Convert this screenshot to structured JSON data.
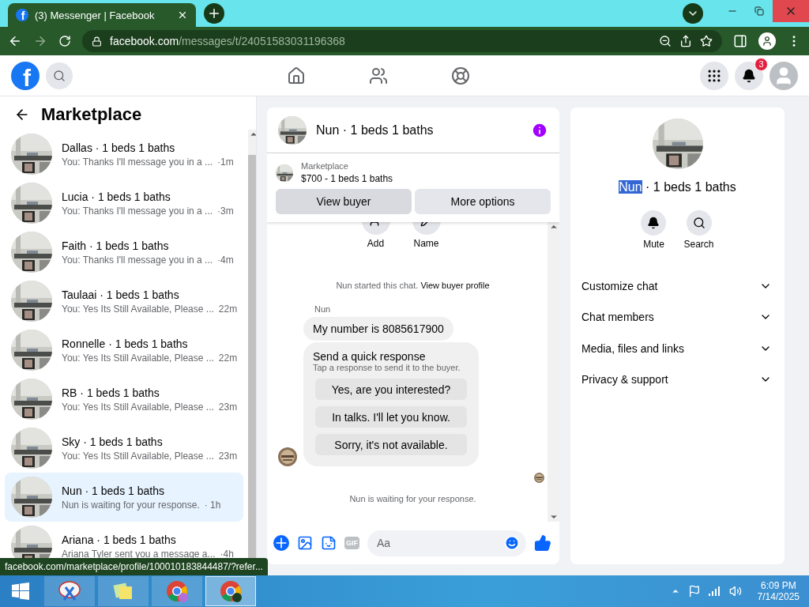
{
  "browser": {
    "tab_title": "(3) Messenger | Facebook",
    "url_domain": "facebook.com",
    "url_path": "/messages/t/24051583031196368",
    "status_url": "facebook.com/marketplace/profile/100010183844487/?refer..."
  },
  "topbar": {
    "tab_logo": "f",
    "logo": "f",
    "notification_count": "3"
  },
  "sidebar": {
    "title": "Marketplace",
    "conversations": [
      {
        "name": "Dallas · 1 beds 1 baths",
        "preview": "You: Thanks I'll message you in a ...",
        "time": "·1m",
        "selected": false
      },
      {
        "name": "Lucia · 1 beds 1 baths",
        "preview": "You: Thanks I'll message you in a ...",
        "time": "·3m",
        "selected": false
      },
      {
        "name": "Faith · 1 beds 1 baths",
        "preview": "You: Thanks I'll message you in a ...",
        "time": "·4m",
        "selected": false
      },
      {
        "name": "Taulaai · 1 beds 1 baths",
        "preview": "You: Yes Its Still Available, Please ...",
        "time": "22m",
        "selected": false
      },
      {
        "name": "Ronnelle · 1 beds 1 baths",
        "preview": "You: Yes Its Still Available, Please ...",
        "time": "22m",
        "selected": false
      },
      {
        "name": "RB · 1 beds 1 baths",
        "preview": "You: Yes Its Still Available, Please ...",
        "time": "23m",
        "selected": false
      },
      {
        "name": "Sky · 1 beds 1 baths",
        "preview": "You: Yes Its Still Available, Please ...",
        "time": "23m",
        "selected": false
      },
      {
        "name": "Nun · 1 beds 1 baths",
        "preview": "Nun is waiting for your response.",
        "time": "· 1h",
        "selected": true
      },
      {
        "name": "Ariana · 1 beds 1 baths",
        "preview": "Ariana Tyler sent you a message a...",
        "time": "·4h",
        "selected": false
      }
    ]
  },
  "chat": {
    "title": "Nun · 1 beds 1 baths",
    "listing_label": "Marketplace",
    "listing_title": "$700 - 1 beds 1 baths",
    "buttons": [
      "View buyer",
      "More options"
    ],
    "actions": [
      "Add",
      "Name"
    ],
    "system_text": "Nun started this chat.",
    "system_link": "View buyer profile",
    "sender": "Nun",
    "message": "My number is 8085617900",
    "quick_title": "Send a quick response",
    "quick_subtitle": "Tap a response to send it to the buyer.",
    "quick_options": [
      "Yes, are you interested?",
      "In talks. I'll let you know.",
      "Sorry, it's not available."
    ],
    "waiting_text": "Nun is waiting for your response.",
    "composer_placeholder": "Aa",
    "gif_label": "GIF"
  },
  "info_panel": {
    "name": "Nun",
    "name_highlighted": true,
    "name_rest": " · 1 beds 1 baths",
    "actions": [
      "Mute",
      "Search"
    ],
    "sections": [
      {
        "label": "Customize chat",
        "expanded": false
      },
      {
        "label": "Chat members",
        "expanded": false
      },
      {
        "label": "Media, files and links",
        "expanded": false
      },
      {
        "label": "Privacy & support",
        "expanded": false
      }
    ]
  },
  "taskbar": {
    "apps": [
      {
        "kind": "paint",
        "active": false
      },
      {
        "kind": "notes",
        "active": false
      },
      {
        "kind": "chrome",
        "active": false
      },
      {
        "kind": "chrome-profile",
        "active": true
      }
    ],
    "time": "6:09 PM",
    "date": "7/14/2025"
  }
}
